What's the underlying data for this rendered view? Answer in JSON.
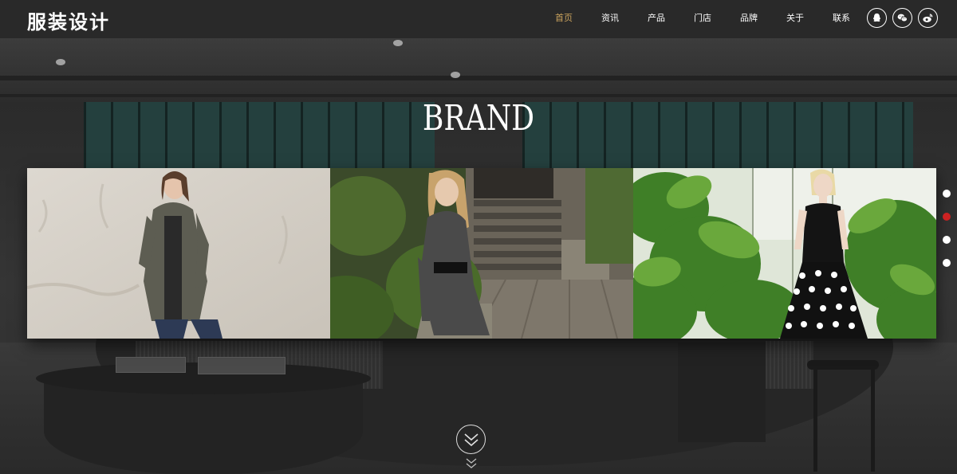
{
  "header": {
    "logo": "服装设计",
    "nav": [
      {
        "label": "首页",
        "active": true
      },
      {
        "label": "资讯",
        "active": false
      },
      {
        "label": "产品",
        "active": false
      },
      {
        "label": "门店",
        "active": false
      },
      {
        "label": "品牌",
        "active": false
      },
      {
        "label": "关于",
        "active": false
      },
      {
        "label": "联系",
        "active": false
      }
    ],
    "social_icons": [
      "qq-icon",
      "wechat-icon",
      "weibo-icon"
    ]
  },
  "hero": {
    "title": "BRAND"
  },
  "gallery": {
    "panels": [
      "model-gray-coat",
      "model-stairs-garden",
      "model-polka-dress-greenhouse"
    ]
  },
  "slider": {
    "dot_count": 4,
    "active_index": 1
  },
  "colors": {
    "accent": "#c9a25d",
    "active_dot": "#cc2222"
  },
  "scroll_icon": "double-chevron-down-icon"
}
